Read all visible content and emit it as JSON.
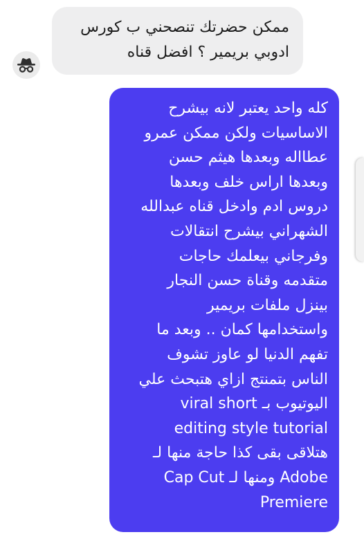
{
  "colors": {
    "incoming_bubble": "#eeeeef",
    "outgoing_bubble": "#4c3df0",
    "outgoing_text": "#ffffff",
    "incoming_text": "#1d1d1d"
  },
  "incoming_message": {
    "avatar_icon": "incognito-spy-icon",
    "lines": [
      "ممكن حضرتك تنصحني ب كورس",
      "ادوبي بريمير ؟ افضل قناه"
    ]
  },
  "outgoing_message": {
    "lines": [
      "كله واحد يعتبر لانه بيشرح",
      "الاساسيات ولكن ممكن عمرو",
      "عطااله وبعدها هيثم حسن",
      "وبعدها اراس خلف وبعدها",
      "دروس ادم وادخل قناه عبدالله",
      "الشهراني بيشرح انتقالات",
      "وفرجاني بيعلمك حاجات",
      "متقدمه وقناة حسن النجار",
      "بينزل ملفات بريمير",
      "واستخدامها كمان .. وبعد ما",
      "تفهم الدنيا لو عاوز تشوف",
      "الناس بتمنتج ازاي هتبحث علي",
      "اليوتيوب بـ  viral short",
      "editing style tutorial",
      "هتلاقى بقى كذا حاجة منها لـ",
      "Cap Cut ومنها لـ Adobe",
      "Premiere"
    ]
  }
}
